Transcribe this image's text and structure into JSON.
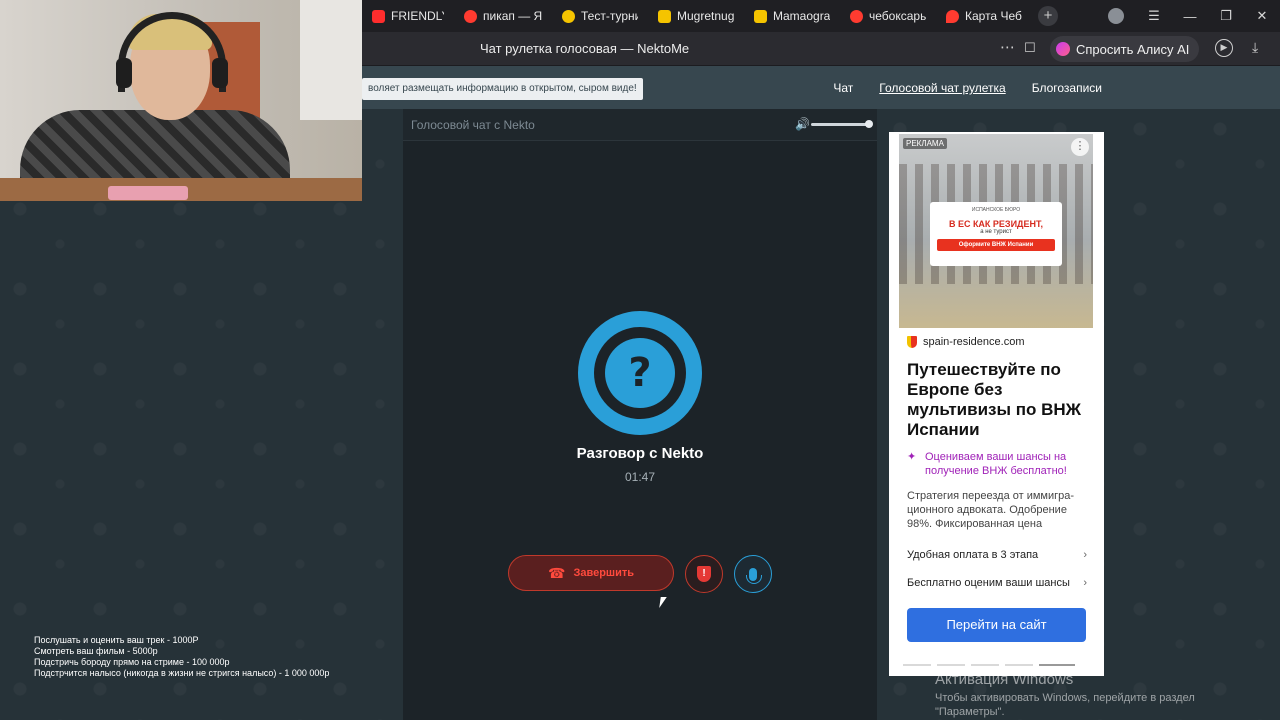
{
  "browser": {
    "tabs": [
      {
        "label": "FRIENDLY T",
        "color": "#ff2d2d"
      },
      {
        "label": "пикап — Ян",
        "color": "#ff3b30"
      },
      {
        "label": "Тест-турни",
        "color": "#2f2f2f"
      },
      {
        "label": "Mugretnug",
        "color": "#f5c400"
      },
      {
        "label": "Mamaogra",
        "color": "#f5c400"
      },
      {
        "label": "чебоксары",
        "color": "#ff3b30"
      },
      {
        "label": "Карта Чебо",
        "color": "#ff3b30"
      }
    ],
    "page_title": "Чат рулетка голосовая — NektoMe",
    "alice_label": "Спросить Алису AI"
  },
  "site": {
    "notice": "воляет размещать информацию в открытом, сыром виде!",
    "nav": [
      "Чат",
      "Голосовой чат рулетка",
      "Блогозаписи"
    ]
  },
  "chat": {
    "header_title": "Голосовой чат с Nekto",
    "avatar_symbol": "?",
    "conversation_title": "Разговор с Nekto",
    "timer": "01:47",
    "end_button": "Завершить",
    "report_symbol": "!"
  },
  "ad": {
    "label": "РЕКЛАМА",
    "image_brand": "ИСПАНСКОЕ БЮРО",
    "image_headline": "В ЕС КАК РЕЗИДЕНТ,",
    "image_sub": "а не турист",
    "image_button": "Оформите ВНЖ Испании",
    "domain": "spain-residence.com",
    "headline": "Путешествуйте по Европе без мультивизы по ВНЖ Испании",
    "offer": "Оцениваем ваши шансы на получение ВНЖ бесплатно!",
    "description": "Стратегия переезда от иммигра-ционного адвоката. Одобрение 98%. Фиксированная цена",
    "links": [
      "Удобная оплата в 3 этапа",
      "Бесплатно оценим ваши шансы"
    ],
    "cta": "Перейти на сайт"
  },
  "stream_overlay": {
    "lines": [
      "Послушать и оценить ваш трек - 1000Р",
      "Смотреть ваш фильм - 5000р",
      "Подстричь бороду прямо на стриме - 100 000р",
      "Подстрчится налысо (никогда в жизни не стригся налысо) - 1 000 000р"
    ]
  },
  "windows_activation": {
    "title": "Активация Windows",
    "line1": "Чтобы активировать Windows, перейдите в раздел",
    "line2": "\"Параметры\"."
  },
  "colors": {
    "accent_blue": "#2a9fd8",
    "end_red": "#ff4a3d",
    "cta_blue": "#2f6fe0",
    "offer_purple": "#a022b8"
  }
}
